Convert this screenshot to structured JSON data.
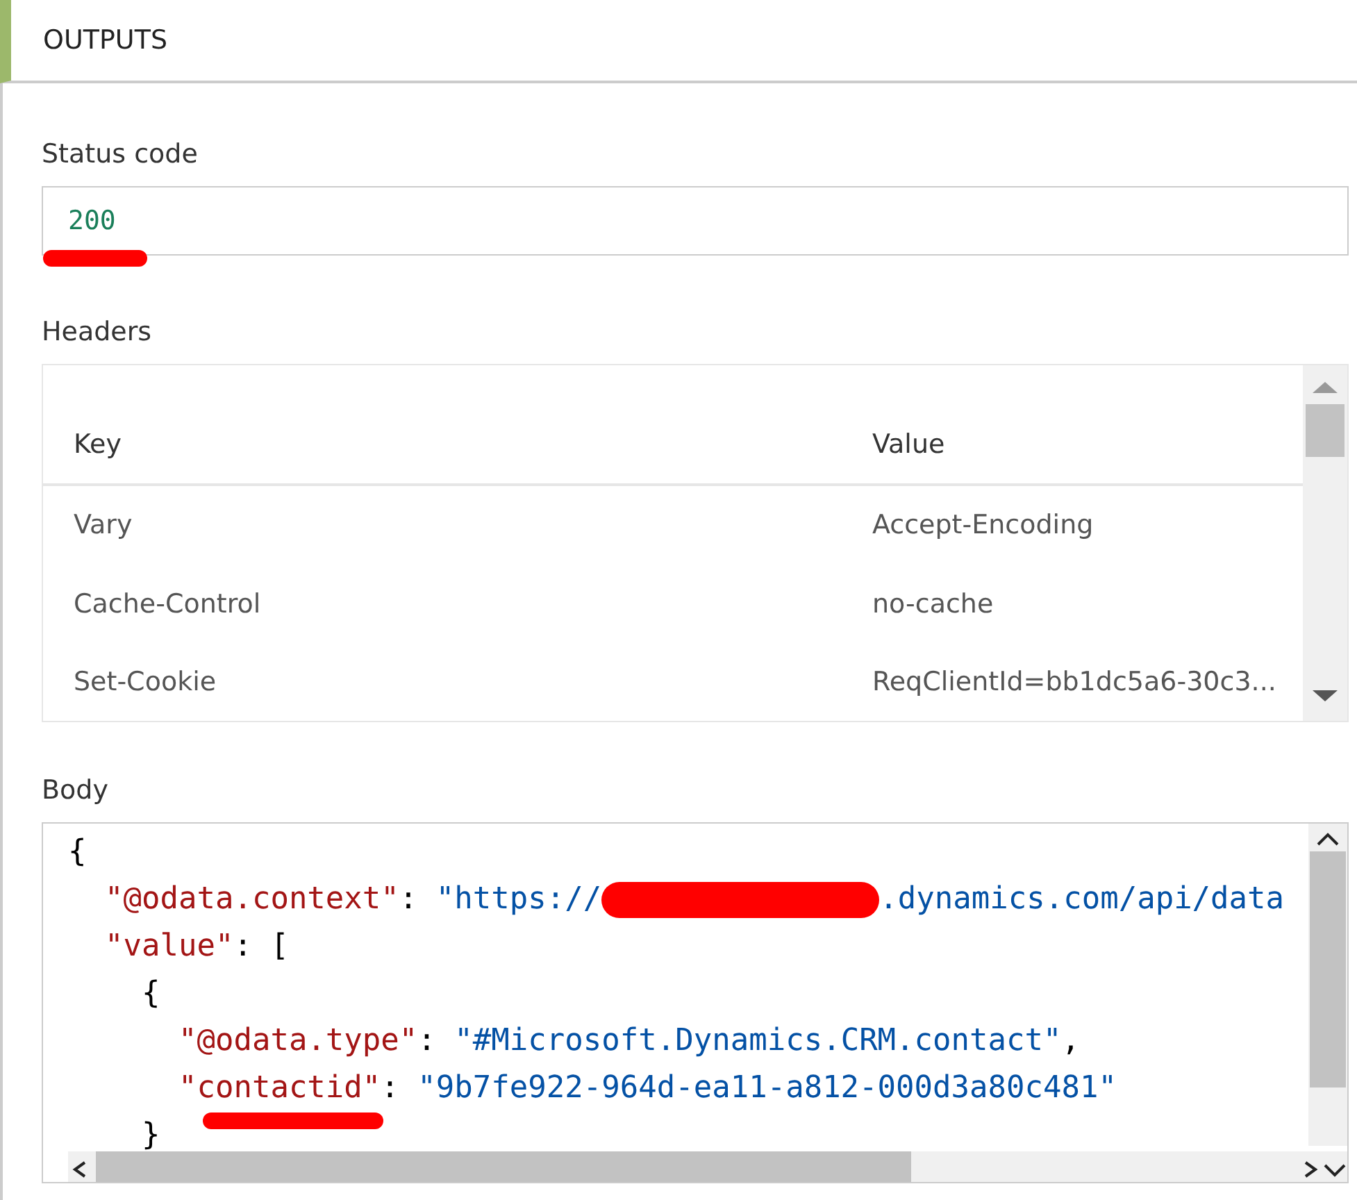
{
  "section_title": "OUTPUTS",
  "status_code": {
    "label": "Status code",
    "value": "200"
  },
  "headers": {
    "label": "Headers",
    "columns": [
      "Key",
      "Value"
    ],
    "rows": [
      {
        "key": "Vary",
        "value": "Accept-Encoding"
      },
      {
        "key": "Cache-Control",
        "value": "no-cache"
      },
      {
        "key": "Set-Cookie",
        "value": "ReqClientId=bb1dc5a6-30c3..."
      }
    ]
  },
  "body": {
    "label": "Body",
    "lines": [
      [
        {
          "kind": "punct",
          "text": "{"
        }
      ],
      [
        {
          "kind": "key",
          "text": "  \"@odata.context\""
        },
        {
          "kind": "punct",
          "text": ": "
        },
        {
          "kind": "string",
          "text": "\"https://"
        },
        {
          "kind": "redaction"
        },
        {
          "kind": "string",
          "text": ".dynamics.com/api/data"
        }
      ],
      [
        {
          "kind": "key",
          "text": "  \"value\""
        },
        {
          "kind": "punct",
          "text": ": ["
        }
      ],
      [
        {
          "kind": "punct",
          "text": "    {"
        }
      ],
      [
        {
          "kind": "key",
          "text": "      \"@odata.type\""
        },
        {
          "kind": "punct",
          "text": ": "
        },
        {
          "kind": "string",
          "text": "\"#Microsoft.Dynamics.CRM.contact\""
        },
        {
          "kind": "punct",
          "text": ","
        }
      ],
      [
        {
          "kind": "key",
          "text": "      \"contactid\""
        },
        {
          "kind": "punct",
          "text": ": "
        },
        {
          "kind": "string",
          "text": "\"9b7fe922-964d-ea11-a812-000d3a80c481\""
        }
      ],
      [
        {
          "kind": "punct",
          "text": "    }"
        }
      ]
    ]
  }
}
